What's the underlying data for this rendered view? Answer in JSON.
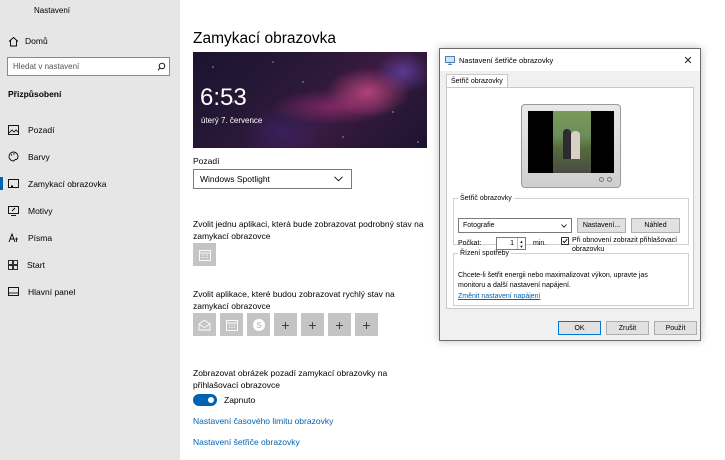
{
  "window": {
    "title": "Nastavení"
  },
  "sidebar": {
    "home": "Domů",
    "search_placeholder": "Hledat v nastavení",
    "section": "Přizpůsobení",
    "items": [
      {
        "label": "Pozadí",
        "icon": "image-icon"
      },
      {
        "label": "Barvy",
        "icon": "palette-icon"
      },
      {
        "label": "Zamykací obrazovka",
        "icon": "lock-screen-icon"
      },
      {
        "label": "Motivy",
        "icon": "theme-brush-icon"
      },
      {
        "label": "Písma",
        "icon": "font-icon"
      },
      {
        "label": "Start",
        "icon": "start-grid-icon"
      },
      {
        "label": "Hlavní panel",
        "icon": "taskbar-icon"
      }
    ]
  },
  "main": {
    "title": "Zamykací obrazovka",
    "preview": {
      "time": "6:53",
      "date": "úterý 7. července"
    },
    "background_label": "Pozadí",
    "background_value": "Windows Spotlight",
    "detailed_status_desc": "Zvolit jednu aplikaci, která bude zobrazovat podrobný stav na zamykací obrazovce",
    "quick_status_desc": "Zvolit aplikace, které budou zobrazovat rychlý stav na zamykací obrazovce",
    "signin_desc": "Zobrazovat obrázek pozadí zamykací obrazovky na přihlašovací obrazovce",
    "toggle_state": "Zapnuto",
    "link_timeout": "Nastavení časového limitu obrazovky",
    "link_screensaver": "Nastavení šetřiče obrazovky"
  },
  "dialog": {
    "title": "Nastavení šetřiče obrazovky",
    "tab": "Šetřič obrazovky",
    "screensaver_group": "Šetřič obrazovky",
    "screensaver_value": "Fotografie",
    "settings_btn": "Nastavení...",
    "preview_btn": "Náhled",
    "wait_label": "Počkat:",
    "wait_value": "1",
    "wait_unit": "min.",
    "resume_label": "Při obnovení zobrazit přihlašovací obrazovku",
    "resume_line1": "Při obnovení zobrazit přihlašovací",
    "resume_line2": "obrazovku",
    "power_group": "Řízení spotřeby",
    "power_desc_line1": "Chcete-li šetřit energii nebo maximalizovat výkon, upravte jas",
    "power_desc_line2": "monitoru a další nastavení napájení.",
    "power_link": "Změnit nastavení napájení",
    "ok": "OK",
    "cancel": "Zrušit",
    "apply": "Použít",
    "close": "✕"
  },
  "colors": {
    "accent": "#0063b1",
    "sidebar_bg": "#e6e6e6",
    "tile_bg": "#c4c4c4"
  }
}
